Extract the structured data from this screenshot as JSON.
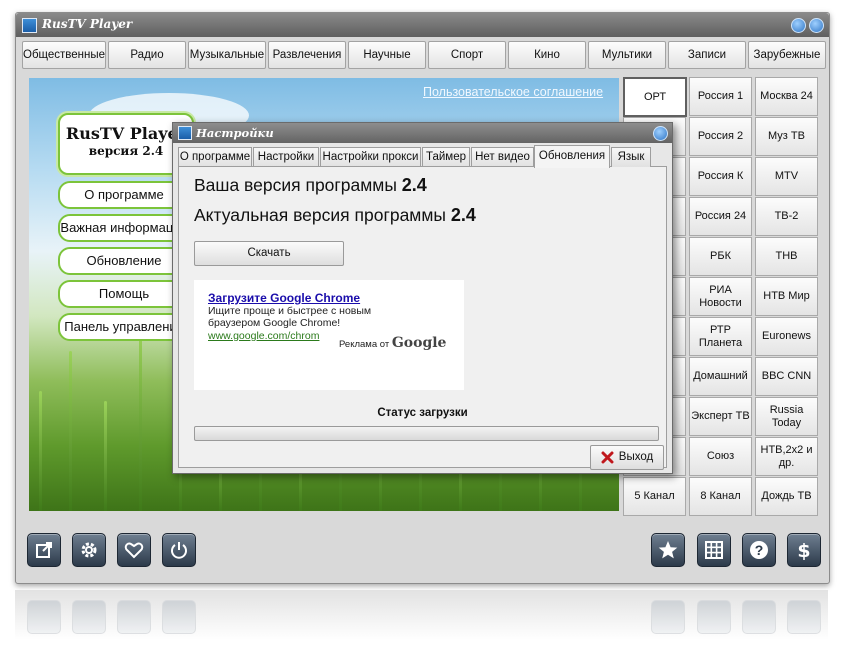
{
  "window": {
    "title": "RusTV Player"
  },
  "categories": [
    "Общественные",
    "Радио",
    "Музыкальные",
    "Развлечения",
    "Научные",
    "Спорт",
    "Кино",
    "Мультики",
    "Записи",
    "Зарубежные"
  ],
  "main": {
    "agreement_link": "Пользовательское соглашение",
    "logo_name": "RusTV Player",
    "logo_version": "версия 2.4",
    "menu": [
      "О программе",
      "Важная информация",
      "Обновление",
      "Помощь",
      "Панель управления"
    ]
  },
  "channels": [
    [
      "ОРТ",
      "Россия 1",
      "Москва 24"
    ],
    [
      "",
      "Россия 2",
      "Муз ТВ"
    ],
    [
      "",
      "Россия К",
      "MTV"
    ],
    [
      "",
      "Россия 24",
      "ТВ-2"
    ],
    [
      "",
      "РБК",
      "ТНВ"
    ],
    [
      "",
      "РИА Новости",
      "НТВ Мир"
    ],
    [
      "",
      "РТР Планета",
      "Euronews"
    ],
    [
      "",
      "Домашний",
      "BBC CNN"
    ],
    [
      "",
      "Эксперт ТВ",
      "Russia Today"
    ],
    [
      "",
      "Союз",
      "НТВ,2x2 и др."
    ],
    [
      "5 Канал",
      "8 Канал",
      "Дождь ТВ"
    ]
  ],
  "dialog": {
    "title": "Настройки",
    "tabs": [
      "О программе",
      "Настройки",
      "Настройки прокси",
      "Таймер",
      "Нет видео",
      "Обновления",
      "Язык"
    ],
    "active_tab": "Обновления",
    "your_version_label": "Ваша версия программы",
    "your_version": "2.4",
    "actual_version_label": "Актуальная версия программы",
    "actual_version": "2.4",
    "download_button": "Скачать",
    "ad": {
      "title": "Загрузите Google Chrome",
      "text": "Ищите проще и быстрее с новым браузером Google Chrome!",
      "url": "www.google.com/chrom",
      "by": "Реклама от",
      "brand": "Google"
    },
    "status_label": "Статус загрузки",
    "progress": 0,
    "exit_button": "Выход"
  },
  "toolbar_left": [
    "external-link-icon",
    "gear-icon",
    "heart-icon",
    "power-icon"
  ],
  "toolbar_right": [
    "star-icon",
    "grid-icon",
    "help-icon",
    "dollar-icon"
  ],
  "colors": {
    "title_bar": "#6e6e6e",
    "pill_border": "#7cc43a",
    "toolbar_button": "#3a4858",
    "close_red": "#c0181d"
  }
}
